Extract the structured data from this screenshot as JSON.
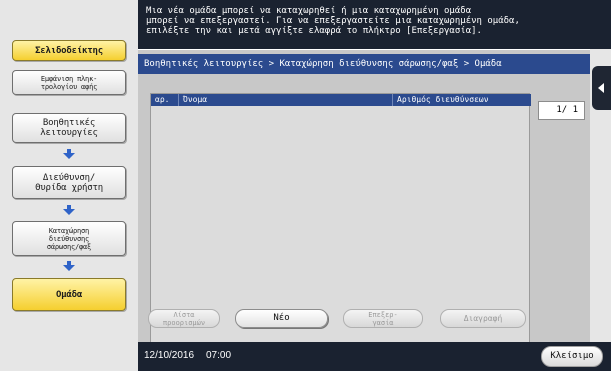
{
  "message": {
    "text": "Μια νέα ομάδα μπορεί να καταχωρηθεί ή μια καταχωρημένη ομάδα\nμπορεί να επεξεργαστεί. Για να επεξεργαστείτε μια καταχωρημένη ομάδα,\nεπιλέξτε την και μετά αγγίξτε ελαφρά το πλήκτρο [Επεξεργασία]."
  },
  "left": {
    "bookmark": "Σελιδοδείκτης",
    "keypad": "Εμφάνιση πληκ-\nτρολογίου αφής",
    "steps": [
      {
        "label": "Βοηθητικές\nλειτουργίες"
      },
      {
        "label": "Διεύθυνση/\nΘυρίδα χρήστη"
      },
      {
        "label": "Καταχώρηση\nδιεύθυνσης\nσάρωσης/φαξ"
      },
      {
        "label": "Ομάδα"
      }
    ]
  },
  "breadcrumb": "Βοηθητικές λειτουργίες > Καταχώρηση διεύθυνσης σάρωσης/φαξ > Ομάδα",
  "table": {
    "headers": [
      "αρ.",
      "Όνομα",
      "Αριθμός διευθύνσεων"
    ],
    "rows": []
  },
  "pager": "1/ 1",
  "actions": {
    "check": "Λίστα\nπροορισμών",
    "new": "Νέο",
    "edit": "Επεξερ-\nγασία",
    "delete": "Διαγραφή"
  },
  "footer": {
    "date": "12/10/2016",
    "time": "07:00",
    "close": "Κλείσιμο"
  },
  "colors": {
    "header_bg": "#1a2230",
    "breadcrumb_bg": "#2b4a8e",
    "highlight": "#f5cf2f",
    "step_arrow": "#2f63c8"
  }
}
